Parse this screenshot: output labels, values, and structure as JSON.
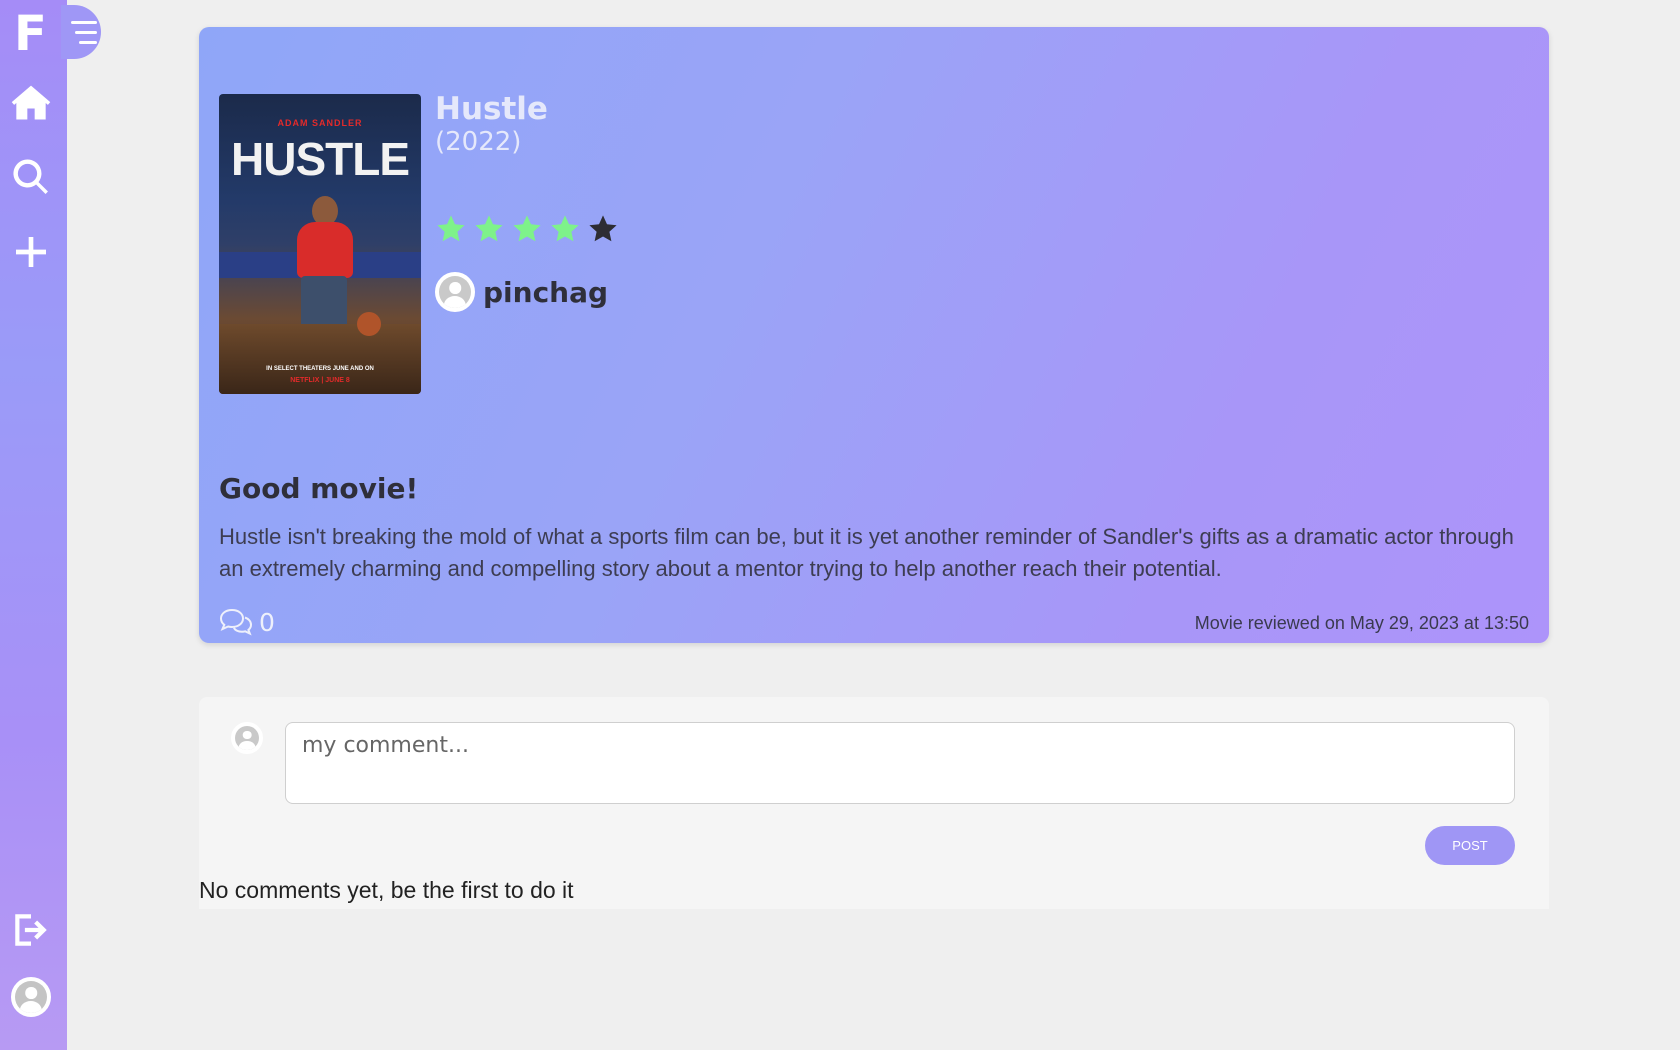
{
  "sidebar": {
    "logo": "F",
    "icons": [
      "menu-icon",
      "home-icon",
      "search-icon",
      "plus-icon",
      "logout-icon",
      "user-avatar-icon"
    ]
  },
  "review": {
    "poster": {
      "actor": "ADAM SANDLER",
      "title": "HUSTLE",
      "tagline": "IN SELECT THEATERS JUNE AND ON",
      "network": "NETFLIX | JUNE 8"
    },
    "movie_title": "Hustle",
    "movie_year": "(2022)",
    "rating": {
      "value": 4,
      "max": 5,
      "filled_color": "#7ef28a",
      "empty_color": "#2d2d33"
    },
    "reviewer": "pinchag",
    "heading": "Good movie!",
    "text": "Hustle isn't breaking the mold of what a sports film can be, but it is yet another reminder of Sandler's gifts as a dramatic actor through an extremely charming and compelling story about a mentor trying to help another reach their potential.",
    "comments_count": "0",
    "reviewed_on": "Movie reviewed on May 29, 2023 at 13:50"
  },
  "comments": {
    "input_placeholder": "my comment...",
    "post_label": "POST",
    "empty_message": "No comments yet, be the first to do it"
  }
}
